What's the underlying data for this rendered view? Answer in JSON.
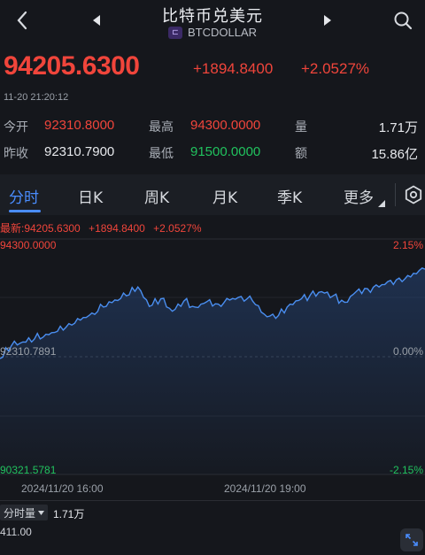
{
  "nav": {
    "title": "比特币兑美元",
    "symbol_badge": "㆗",
    "symbol": "BTCDOLLAR",
    "icons": [
      "back-chevron-icon",
      "prev-arrow-icon",
      "next-arrow-icon",
      "search-icon"
    ]
  },
  "quote": {
    "price": "94205.6300",
    "change": "+1894.8400",
    "change_pct": "+2.0527%",
    "timestamp": "11-20 21:20:12"
  },
  "stats": {
    "open_label": "今开",
    "open": "92310.8000",
    "high_label": "最高",
    "high": "94300.0000",
    "volume_label": "量",
    "volume": "1.71万",
    "prev_close_label": "昨收",
    "prev_close": "92310.7900",
    "low_label": "最低",
    "low": "91500.0000",
    "amount_label": "额",
    "amount": "15.86亿"
  },
  "tabs": [
    "分时",
    "日K",
    "周K",
    "月K",
    "季K",
    "更多"
  ],
  "active_tab": "分时",
  "chart_header": {
    "latest": "最新:94205.6300",
    "change": "+1894.8400",
    "pct": "+2.0527%"
  },
  "chart_data": {
    "type": "line",
    "y_top": "94300.0000",
    "y_mid": "92310.7891",
    "y_bottom": "90321.5781",
    "pct_top": "2.15%",
    "pct_mid": "0.00%",
    "pct_bottom": "-2.15%",
    "x_ticks": [
      "2024/11/20 16:00",
      "2024/11/20 19:00"
    ],
    "ylim": [
      90321.5781,
      94300.0
    ],
    "series": [
      {
        "values": [
          92280,
          92500,
          92560,
          92610,
          92690,
          92740,
          92870,
          92930,
          93050,
          93150,
          93270,
          93340,
          93490,
          93160,
          93290,
          93080,
          93250,
          93150,
          93240,
          93200,
          93270,
          93330,
          93250,
          93030,
          92960,
          93150,
          93260,
          93350,
          93410,
          93340,
          93230,
          93410,
          93460,
          93490,
          93600,
          93580,
          93720,
          93790
        ]
      }
    ]
  },
  "volume": {
    "selector_label": "分时量",
    "value": "1.71万",
    "axis_label": "411.00"
  }
}
